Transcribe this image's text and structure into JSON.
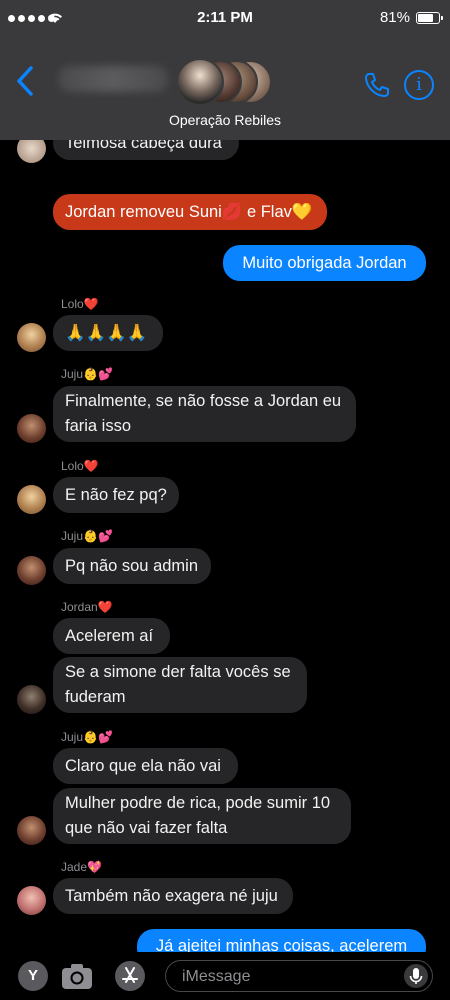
{
  "status_bar": {
    "time": "2:11 PM",
    "battery_text": "81%",
    "battery_level": 0.81
  },
  "header": {
    "group_name": "Operação Rebiles"
  },
  "messages": [
    {
      "text": "Teimosa cabeça dura"
    },
    {
      "text": "Jordan removeu Suni💋 e Flav💛"
    },
    {
      "text": "Muito obrigada Jordan"
    },
    {
      "sender": "Lolo❤️",
      "text": "🙏🙏🙏🙏"
    },
    {
      "sender": "Juju👶💕",
      "text": "Finalmente, se não fosse a Jordan eu faria isso"
    },
    {
      "sender": "Lolo❤️",
      "text": "E não fez pq?"
    },
    {
      "sender": "Juju👶💕",
      "text": "Pq não sou admin"
    },
    {
      "sender": "Jordan❤️",
      "text": "Acelerem aí"
    },
    {
      "text": "Se a simone der falta vocês se fuderam"
    },
    {
      "sender": "Juju👶💕",
      "text": "Claro que ela não vai"
    },
    {
      "text": "Mulher podre de rica, pode sumir 10 que não vai fazer falta"
    },
    {
      "sender": "Jade💖",
      "text": "Também não exagera né juju"
    },
    {
      "text": "Já ajeitei minhas coisas, acelerem"
    }
  ],
  "input": {
    "placeholder": "iMessage"
  },
  "colors": {
    "outgoing": "#0a84ff",
    "incoming": "#262628",
    "system": "#c8391a",
    "header": "#3a3a3c"
  }
}
